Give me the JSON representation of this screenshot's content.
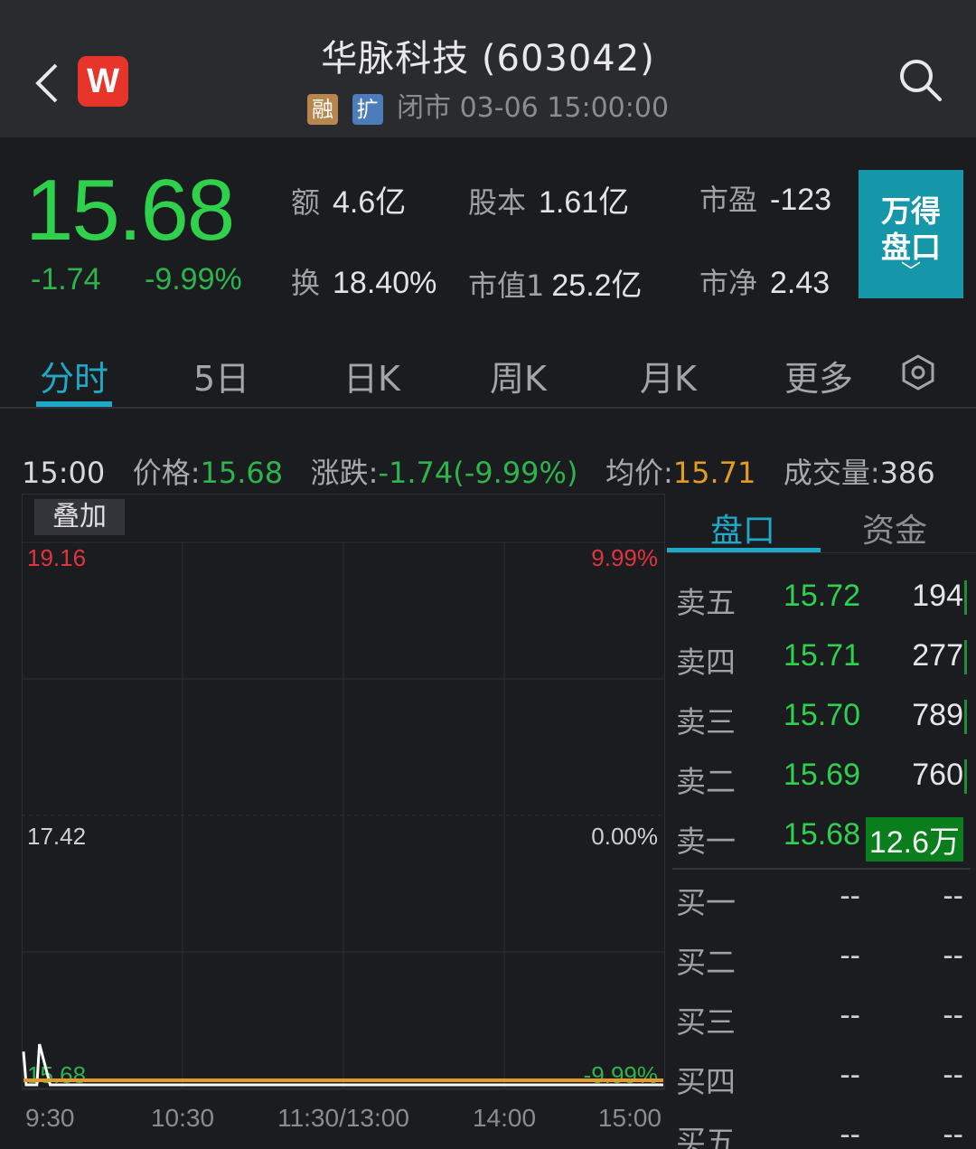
{
  "header": {
    "title": "华脉科技 (603042)",
    "logo_letter": "W",
    "tag_rong": "融",
    "tag_kuo": "扩",
    "status": "闭市 03-06 15:00:00"
  },
  "quote": {
    "price": "15.68",
    "change": "-1.74",
    "change_pct": "-9.99%",
    "stats": [
      {
        "label": "额",
        "value": "4.6亿"
      },
      {
        "label": "股本",
        "value": "1.61亿"
      },
      {
        "label": "市盈",
        "value": "-123"
      },
      {
        "label": "换",
        "value": "18.40%"
      },
      {
        "label": "市值1",
        "value": "25.2亿"
      },
      {
        "label": "市净",
        "value": "2.43"
      }
    ],
    "wind_button_line1": "万得",
    "wind_button_line2": "盘口",
    "wind_button_chevron": "﹀"
  },
  "tabs": [
    {
      "label": "分时"
    },
    {
      "label": "5日"
    },
    {
      "label": "日K"
    },
    {
      "label": "周K"
    },
    {
      "label": "月K"
    },
    {
      "label": "更多"
    }
  ],
  "info_line": {
    "time": "15:00",
    "price_label": "价格:",
    "price": "15.68",
    "change_label": "涨跌:",
    "change": "-1.74(-9.99%)",
    "avg_label": "均价:",
    "avg": "15.71",
    "volume_label": "成交量:",
    "volume": "386"
  },
  "chart_data": {
    "type": "line",
    "overlay_button": "叠加",
    "y_left_ticks": [
      "19.16",
      "17.42",
      "15.68"
    ],
    "y_right_ticks": [
      "9.99%",
      "0.00%",
      "-9.99%"
    ],
    "x_ticks": [
      "9:30",
      "10:30",
      "11:30/13:00",
      "14:00",
      "15:00"
    ],
    "ylim": [
      15.68,
      19.16
    ],
    "series": [
      {
        "values_desc": "price",
        "color": "#ffffff",
        "x": [
          "9:30",
          "9:31",
          "9:32",
          "9:35",
          "9:36",
          "9:40",
          "15:00"
        ],
        "y": [
          15.9,
          15.68,
          15.68,
          15.68,
          15.95,
          15.68,
          15.68
        ]
      },
      {
        "values_desc": "avg",
        "color": "#e49a25",
        "x": [
          "9:30",
          "15:00"
        ],
        "y": [
          15.71,
          15.71
        ]
      }
    ]
  },
  "orderbook": {
    "tabs": [
      "盘口",
      "资金"
    ],
    "asks": [
      {
        "label": "卖五",
        "price": "15.72",
        "vol": "194"
      },
      {
        "label": "卖四",
        "price": "15.71",
        "vol": "277"
      },
      {
        "label": "卖三",
        "price": "15.70",
        "vol": "789"
      },
      {
        "label": "卖二",
        "price": "15.69",
        "vol": "760"
      },
      {
        "label": "卖一",
        "price": "15.68",
        "vol": "12.6万"
      }
    ],
    "bids": [
      {
        "label": "买一",
        "price": "--",
        "vol": "--"
      },
      {
        "label": "买二",
        "price": "--",
        "vol": "--"
      },
      {
        "label": "买三",
        "price": "--",
        "vol": "--"
      },
      {
        "label": "买四",
        "price": "--",
        "vol": "--"
      },
      {
        "label": "买五",
        "price": "--",
        "vol": "--"
      }
    ]
  },
  "colors": {
    "down_green": "#2fd04c",
    "up_red": "#e0343f",
    "accent": "#1fa9c6",
    "avg_orange": "#e49a25"
  }
}
